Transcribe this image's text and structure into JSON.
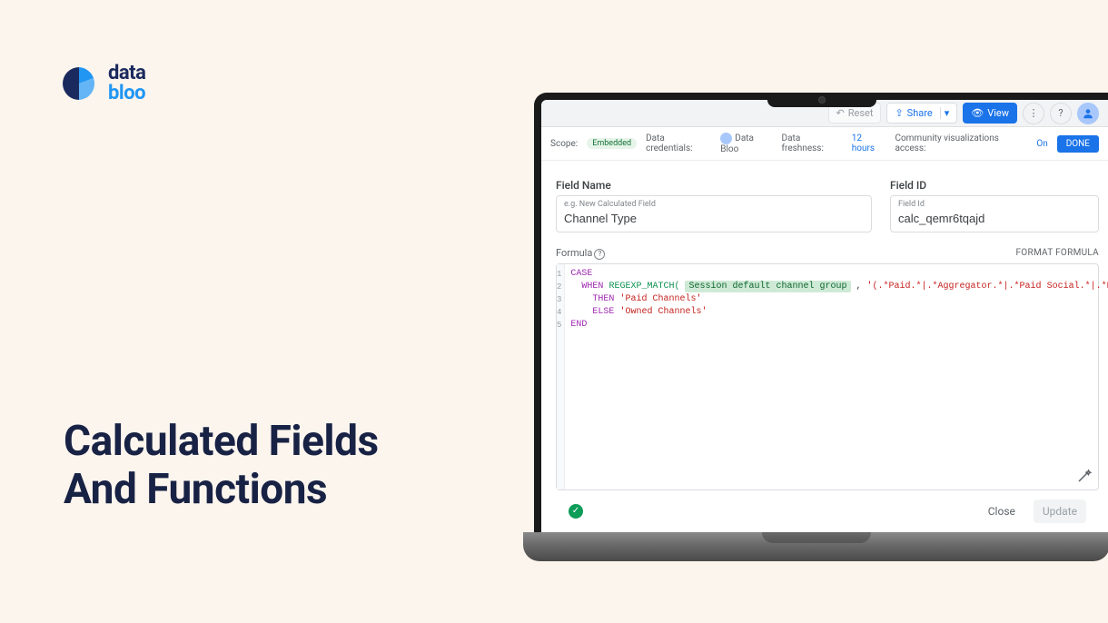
{
  "brand": {
    "line1": "data",
    "line2": "bloo"
  },
  "heading": "Calculated Fields\nAnd Functions",
  "toolbar": {
    "reset": "Reset",
    "share": "Share",
    "view": "View"
  },
  "meta": {
    "scope_label": "Scope:",
    "scope_badge": "Embedded",
    "creds_label": "Data credentials:",
    "creds_value": "Data Bloo",
    "fresh_label": "Data freshness:",
    "fresh_value": "12 hours",
    "viz_label": "Community visualizations access:",
    "viz_value": "On",
    "done": "DONE"
  },
  "fields": {
    "name_label": "Field Name",
    "name_float": "e.g. New Calculated Field",
    "name_value": "Channel Type",
    "id_label": "Field ID",
    "id_float": "Field Id",
    "id_value": "calc_qemr6tqajd"
  },
  "formula": {
    "label": "Formula",
    "format": "FORMAT FORMULA",
    "kw_case": "CASE",
    "kw_when": "WHEN",
    "fn_regex": "REGEXP_MATCH(",
    "chip": "Session default channel group",
    "comma": " , ",
    "pattern": "'(.*Paid.*|.*Aggregator.*|.*Paid Social.*|.*Paid Search.*|.*Display.*|.*Affiliate.*)'",
    "close": ")",
    "kw_then": "THEN",
    "str_paid": "'Paid Channels'",
    "kw_else": "ELSE",
    "str_owned": "'Owned Channels'",
    "kw_end": "END"
  },
  "footer": {
    "close": "Close",
    "update": "Update"
  }
}
